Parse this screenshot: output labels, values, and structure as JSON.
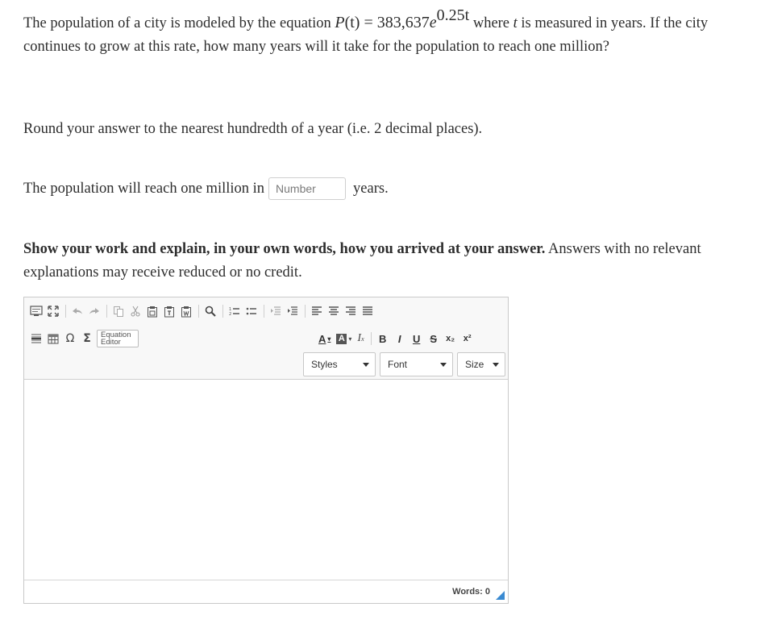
{
  "question": {
    "lead": "The population of a city is modeled by the equation",
    "equation_lhs": "P",
    "equation_arg": "(t)",
    "equation_eq": " = 383,637",
    "equation_base": "e",
    "equation_exp": "0.25t",
    "after_eq": " where",
    "var_t": "t",
    "tail": " is measured in years. If the city continues to grow at this rate, how many years will it take for the population to reach one million?"
  },
  "rounding": "Round your answer to the nearest hundredth of a year (i.e. 2 decimal places).",
  "answer": {
    "prefix": "The population will reach one million in",
    "placeholder": "Number",
    "value": "",
    "suffix": "years."
  },
  "show_work": {
    "bold": "Show your work and explain, in your own words, how you arrived at your answer.",
    "rest": " Answers with no relevant explanations may receive reduced or no credit."
  },
  "editor": {
    "equation_editor_line1": "Equation",
    "equation_editor_line2": "Editor",
    "styles_label": "Styles",
    "font_label": "Font",
    "size_label": "Size",
    "bold_btn": "B",
    "italic_btn": "I",
    "underline_btn": "U",
    "strike_btn": "S",
    "subscript_btn": "x₂",
    "superscript_btn": "x²",
    "omega_btn": "Ω",
    "sigma_btn": "Σ",
    "words_label": "Words: 0",
    "resize_color": "#3a8ad1"
  }
}
